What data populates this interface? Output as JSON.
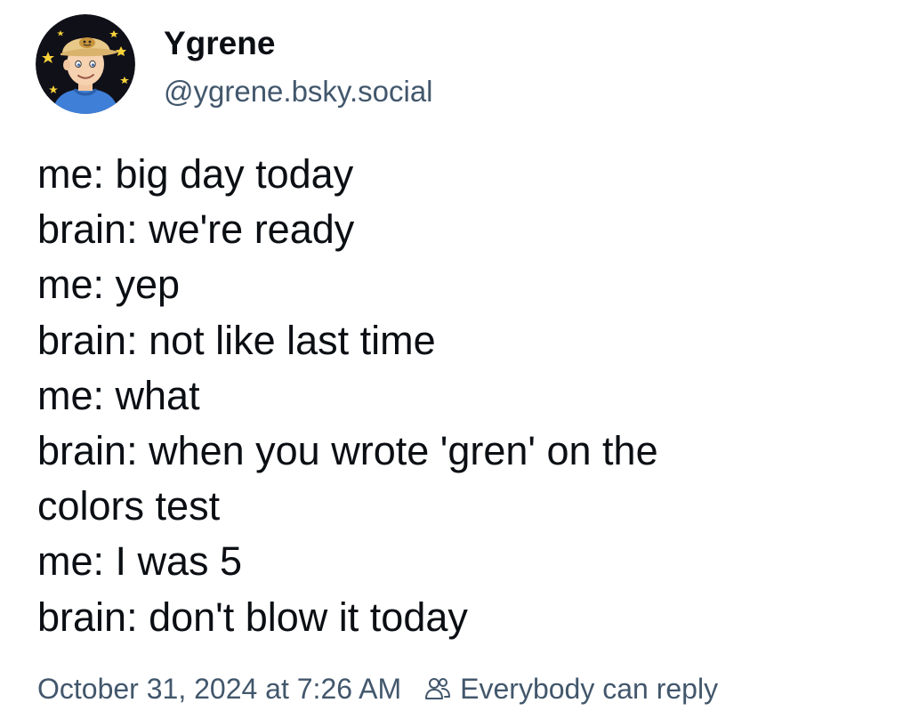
{
  "author": {
    "display_name": "Ygrene",
    "handle": "@ygrene.bsky.social",
    "avatar_icon": "cartoon-avatar-icon"
  },
  "post": {
    "lines": [
      "me: big day today",
      "brain: we're ready",
      "me: yep",
      "brain: not like last time",
      "me: what",
      "brain: when you wrote 'gren' on the",
      "colors test",
      "me: I was 5",
      "brain: don't blow it today"
    ]
  },
  "meta": {
    "timestamp": "October 31, 2024 at 7:26 AM",
    "reply_setting_icon": "people-icon",
    "reply_setting": "Everybody can reply"
  },
  "colors": {
    "text": "#0b0f14",
    "secondary": "#42576c",
    "background": "#ffffff"
  }
}
